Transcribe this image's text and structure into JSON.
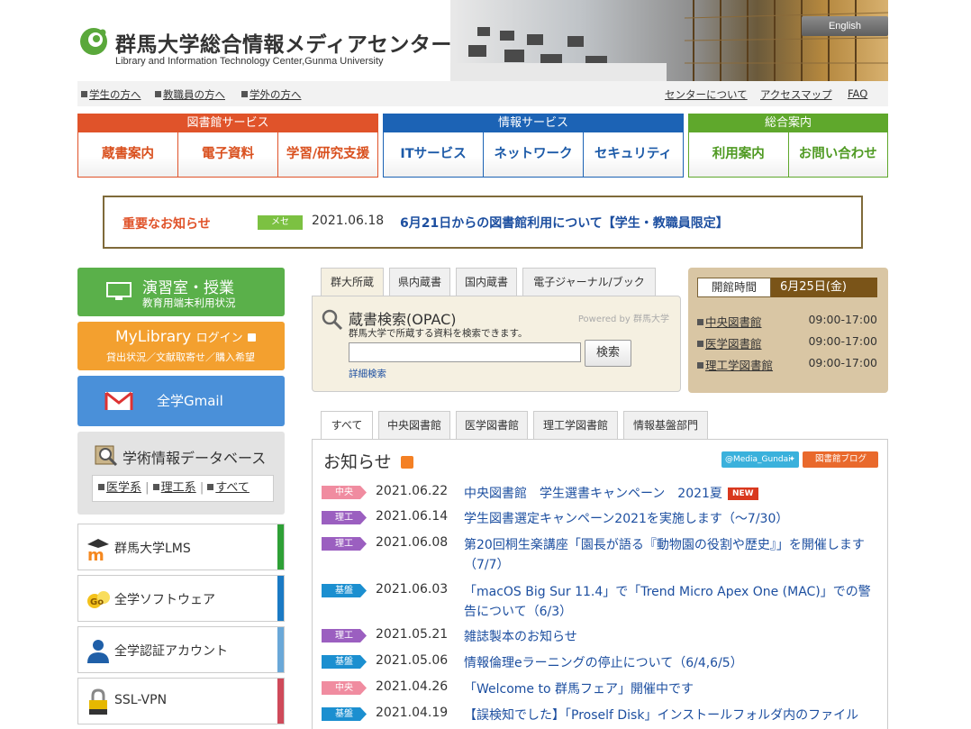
{
  "header": {
    "title": "群馬大学総合情報メディアセンター",
    "subtitle": "Library and Information Technology Center,Gunma University",
    "english_label": "English"
  },
  "utility_links": {
    "left": [
      "学生の方へ",
      "教職員の方へ",
      "学外の方へ"
    ],
    "right": [
      "センターについて",
      "アクセスマップ",
      "FAQ"
    ]
  },
  "nav": {
    "library": {
      "title": "図書館サービス",
      "items": [
        "蔵書案内",
        "電子資料",
        "学習/研究支援"
      ],
      "color": "#e0532a"
    },
    "info": {
      "title": "情報サービス",
      "items": [
        "ITサービス",
        "ネットワーク",
        "セキュリティ"
      ],
      "color": "#1c63b5"
    },
    "general": {
      "title": "総合案内",
      "items": [
        "利用案内",
        "お問い合わせ"
      ],
      "color": "#5fa82c"
    }
  },
  "notice": {
    "label": "重要なお知らせ",
    "tag": "メセ",
    "date": "2021.06.18",
    "text": "6月21日からの図書館利用について【学生・教職員限定】"
  },
  "sidebar": {
    "enshu": {
      "title": "演習室・授業",
      "sub": "教育用端末利用状況"
    },
    "mylibrary": {
      "title": "MyLibrary",
      "login": "ログイン",
      "sub": "貸出状況／文献取寄せ／購入希望"
    },
    "gmail": {
      "title": "全学Gmail"
    },
    "db": {
      "title": "学術情報データベース",
      "links": [
        "医学系",
        "理工系",
        "すべて"
      ]
    },
    "services": [
      {
        "label": "群馬大学LMS"
      },
      {
        "label": "全学ソフトウェア"
      },
      {
        "label": "全学認証アカウント"
      },
      {
        "label": "SSL-VPN"
      }
    ]
  },
  "search": {
    "tabs": [
      "群大所蔵",
      "県内蔵書",
      "国内蔵書",
      "電子ジャーナル/ブック"
    ],
    "title": "蔵書検索(OPAC)",
    "powered": "Powered by 群馬大学",
    "description": "群馬大学で所蔵する資料を検索できます。",
    "input_value": "",
    "button": "検索",
    "advanced": "詳細検索"
  },
  "hours": {
    "label": "開館時間",
    "date": "6月25日(金)",
    "rows": [
      {
        "name": "中央図書館",
        "time": "09:00-17:00"
      },
      {
        "name": "医学図書館",
        "time": "09:00-17:00"
      },
      {
        "name": "理工学図書館",
        "time": "09:00-17:00"
      }
    ]
  },
  "news": {
    "tabs": [
      "すべて",
      "中央図書館",
      "医学図書館",
      "理工学図書館",
      "情報基盤部門"
    ],
    "title": "お知らせ",
    "twitter": "@Media_Gundai",
    "blog": "図書館ブログ",
    "new_label": "NEW",
    "items": [
      {
        "cat": "中央",
        "date": "2021.06.22",
        "text": "中央図書館　学生選書キャンペーン　2021夏"
      },
      {
        "cat": "理工",
        "date": "2021.06.14",
        "text": "学生図書選定キャンペーン2021を実施します（〜7/30）"
      },
      {
        "cat": "理工",
        "date": "2021.06.08",
        "text": "第20回桐生楽講座「園長が語る『動物園の役割や歴史』」を開催します（7/7）"
      },
      {
        "cat": "基盤",
        "date": "2021.06.03",
        "text": "「macOS Big Sur 11.4」で「Trend Micro Apex One (MAC)」での警告について（6/3）"
      },
      {
        "cat": "理工",
        "date": "2021.05.21",
        "text": "雑誌製本のお知らせ"
      },
      {
        "cat": "基盤",
        "date": "2021.05.06",
        "text": "情報倫理eラーニングの停止について（6/4,6/5）"
      },
      {
        "cat": "中央",
        "date": "2021.04.26",
        "text": "「Welcome to 群馬フェア」開催中です"
      },
      {
        "cat": "基盤",
        "date": "2021.04.19",
        "text": "【誤検知でした】「Proself Disk」インストールフォルダ内のファイル"
      }
    ]
  },
  "colors": {
    "central": "#f08ca0",
    "riko": "#9b5fc0",
    "kiban": "#1b8fd0"
  }
}
